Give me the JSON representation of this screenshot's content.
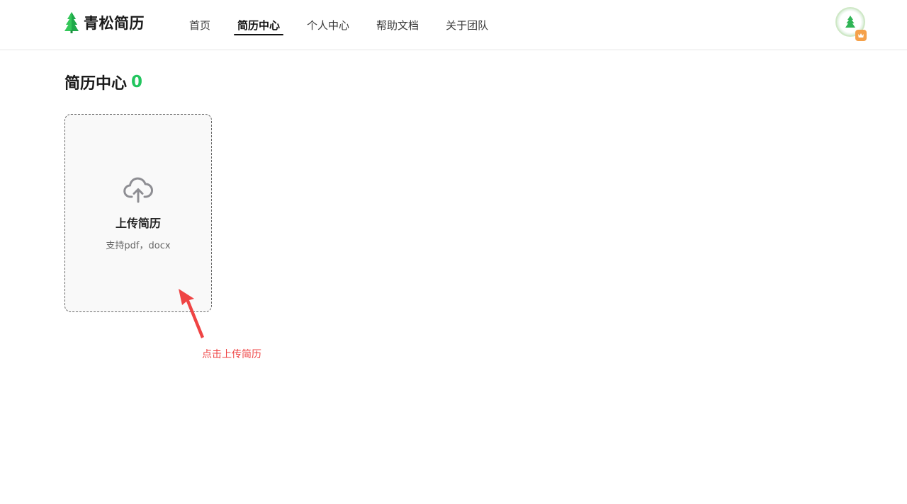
{
  "header": {
    "logo_text": "青松简历",
    "nav": [
      {
        "label": "首页",
        "active": false
      },
      {
        "label": "简历中心",
        "active": true
      },
      {
        "label": "个人中心",
        "active": false
      },
      {
        "label": "帮助文档",
        "active": false
      },
      {
        "label": "关于团队",
        "active": false
      }
    ]
  },
  "main": {
    "title": "简历中心",
    "count": "0",
    "upload": {
      "label": "上传简历",
      "hint": "支持pdf，docx",
      "icon": "cloud-upload-icon"
    },
    "annotation": "点击上传简历"
  },
  "colors": {
    "brand": "#22c55e",
    "annotation": "#ef4444"
  }
}
